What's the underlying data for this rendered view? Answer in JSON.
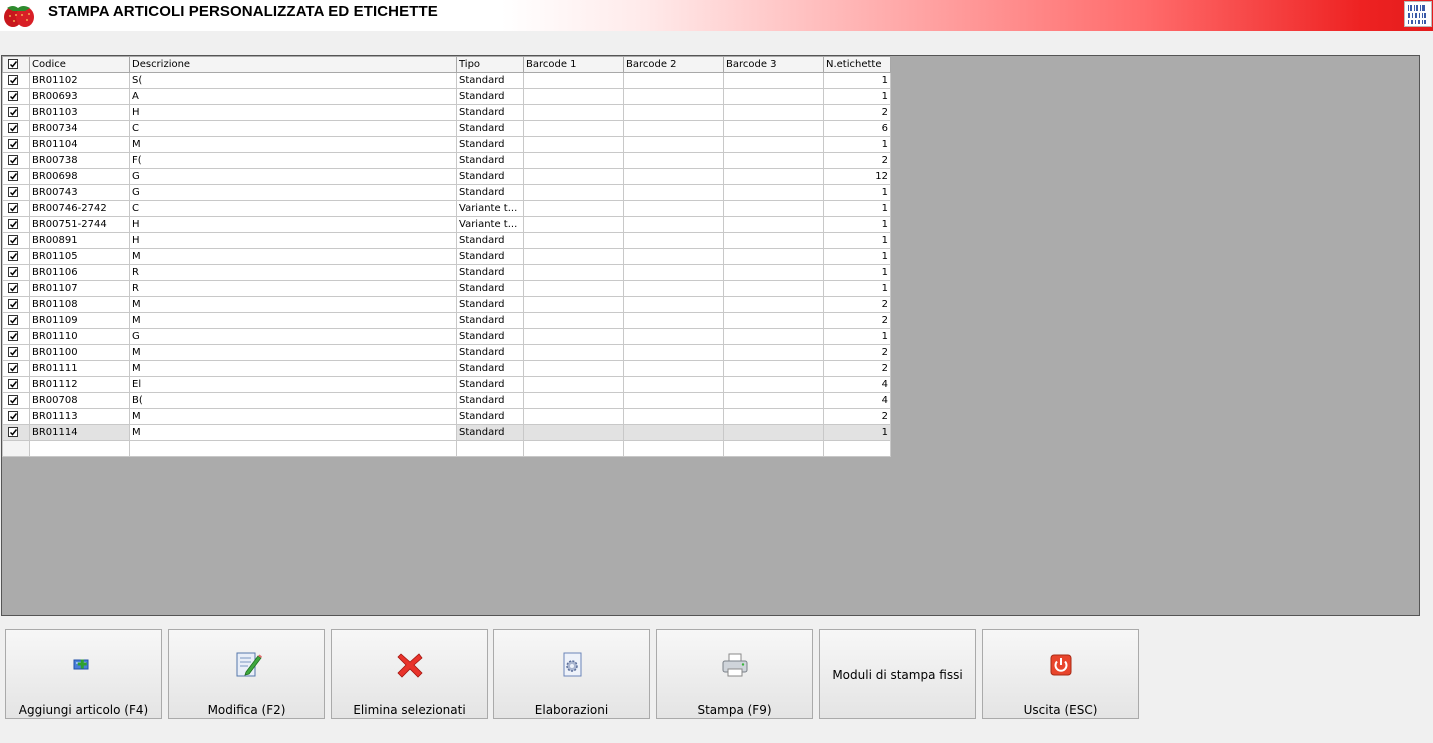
{
  "window": {
    "title": "STAMPA ARTICOLI PERSONALIZZATA ED ETICHETTE",
    "logo_icon": "strawberry-icon",
    "corner_icon": "barcode-icon"
  },
  "grid": {
    "columns": [
      "Codice",
      "Descrizione",
      "Tipo",
      "Barcode 1",
      "Barcode 2",
      "Barcode 3",
      "N.etichette"
    ],
    "header_checkbox_checked": true,
    "rows": [
      {
        "checked": true,
        "codice": "BR01102",
        "descrizione": "S(",
        "tipo": "Standard",
        "barcode1": "",
        "barcode2": "",
        "barcode3": "",
        "n_etichette": "1"
      },
      {
        "checked": true,
        "codice": "BR00693",
        "descrizione": "A",
        "tipo": "Standard",
        "barcode1": "",
        "barcode2": "",
        "barcode3": "",
        "n_etichette": "1"
      },
      {
        "checked": true,
        "codice": "BR01103",
        "descrizione": "H",
        "tipo": "Standard",
        "barcode1": "",
        "barcode2": "",
        "barcode3": "",
        "n_etichette": "2"
      },
      {
        "checked": true,
        "codice": "BR00734",
        "descrizione": "C",
        "tipo": "Standard",
        "barcode1": "",
        "barcode2": "",
        "barcode3": "",
        "n_etichette": "6"
      },
      {
        "checked": true,
        "codice": "BR01104",
        "descrizione": "M",
        "tipo": "Standard",
        "barcode1": "",
        "barcode2": "",
        "barcode3": "",
        "n_etichette": "1"
      },
      {
        "checked": true,
        "codice": "BR00738",
        "descrizione": "F(",
        "tipo": "Standard",
        "barcode1": "",
        "barcode2": "",
        "barcode3": "",
        "n_etichette": "2"
      },
      {
        "checked": true,
        "codice": "BR00698",
        "descrizione": "G",
        "tipo": "Standard",
        "barcode1": "",
        "barcode2": "",
        "barcode3": "",
        "n_etichette": "12"
      },
      {
        "checked": true,
        "codice": "BR00743",
        "descrizione": "G",
        "tipo": "Standard",
        "barcode1": "",
        "barcode2": "",
        "barcode3": "",
        "n_etichette": "1"
      },
      {
        "checked": true,
        "codice": "BR00746-2742",
        "descrizione": "C",
        "tipo": "Variante t...",
        "barcode1": "",
        "barcode2": "",
        "barcode3": "",
        "n_etichette": "1"
      },
      {
        "checked": true,
        "codice": "BR00751-2744",
        "descrizione": "H",
        "tipo": "Variante t...",
        "barcode1": "",
        "barcode2": "",
        "barcode3": "",
        "n_etichette": "1"
      },
      {
        "checked": true,
        "codice": "BR00891",
        "descrizione": "H",
        "tipo": "Standard",
        "barcode1": "",
        "barcode2": "",
        "barcode3": "",
        "n_etichette": "1"
      },
      {
        "checked": true,
        "codice": "BR01105",
        "descrizione": "M",
        "tipo": "Standard",
        "barcode1": "",
        "barcode2": "",
        "barcode3": "",
        "n_etichette": "1"
      },
      {
        "checked": true,
        "codice": "BR01106",
        "descrizione": "R",
        "tipo": "Standard",
        "barcode1": "",
        "barcode2": "",
        "barcode3": "",
        "n_etichette": "1"
      },
      {
        "checked": true,
        "codice": "BR01107",
        "descrizione": "R",
        "tipo": "Standard",
        "barcode1": "",
        "barcode2": "",
        "barcode3": "",
        "n_etichette": "1"
      },
      {
        "checked": true,
        "codice": "BR01108",
        "descrizione": "M",
        "tipo": "Standard",
        "barcode1": "",
        "barcode2": "",
        "barcode3": "",
        "n_etichette": "2"
      },
      {
        "checked": true,
        "codice": "BR01109",
        "descrizione": "M",
        "tipo": "Standard",
        "barcode1": "",
        "barcode2": "",
        "barcode3": "",
        "n_etichette": "2"
      },
      {
        "checked": true,
        "codice": "BR01110",
        "descrizione": "G",
        "tipo": "Standard",
        "barcode1": "",
        "barcode2": "",
        "barcode3": "",
        "n_etichette": "1"
      },
      {
        "checked": true,
        "codice": "BR01100",
        "descrizione": "M",
        "tipo": "Standard",
        "barcode1": "",
        "barcode2": "",
        "barcode3": "",
        "n_etichette": "2"
      },
      {
        "checked": true,
        "codice": "BR01111",
        "descrizione": "M",
        "tipo": "Standard",
        "barcode1": "",
        "barcode2": "",
        "barcode3": "",
        "n_etichette": "2"
      },
      {
        "checked": true,
        "codice": "BR01112",
        "descrizione": "El",
        "tipo": "Standard",
        "barcode1": "",
        "barcode2": "",
        "barcode3": "",
        "n_etichette": "4"
      },
      {
        "checked": true,
        "codice": "BR00708",
        "descrizione": "B(",
        "tipo": "Standard",
        "barcode1": "",
        "barcode2": "",
        "barcode3": "",
        "n_etichette": "4"
      },
      {
        "checked": true,
        "codice": "BR01113",
        "descrizione": "M",
        "tipo": "Standard",
        "barcode1": "",
        "barcode2": "",
        "barcode3": "",
        "n_etichette": "2"
      },
      {
        "checked": true,
        "codice": "BR01114",
        "descrizione": "M",
        "tipo": "Standard",
        "barcode1": "",
        "barcode2": "",
        "barcode3": "",
        "n_etichette": "1",
        "selected": true
      }
    ]
  },
  "buttons": [
    {
      "id": "add",
      "label": "Aggiungi articolo (F4)",
      "icon": "add-item-icon"
    },
    {
      "id": "edit",
      "label": "Modifica (F2)",
      "icon": "edit-document-icon"
    },
    {
      "id": "delete",
      "label": "Elimina selezionati",
      "icon": "red-x-icon"
    },
    {
      "id": "process",
      "label": "Elaborazioni",
      "icon": "document-gear-icon"
    },
    {
      "id": "print",
      "label": "Stampa (F9)",
      "icon": "printer-icon"
    },
    {
      "id": "fixed",
      "label": "Moduli di stampa fissi",
      "icon": ""
    },
    {
      "id": "exit",
      "label": "Uscita (ESC)",
      "icon": "power-icon"
    }
  ],
  "colors": {
    "title_gradient_end": "#e31c1c",
    "grid_background": "#ababab",
    "window_background": "#f0f0f0"
  }
}
